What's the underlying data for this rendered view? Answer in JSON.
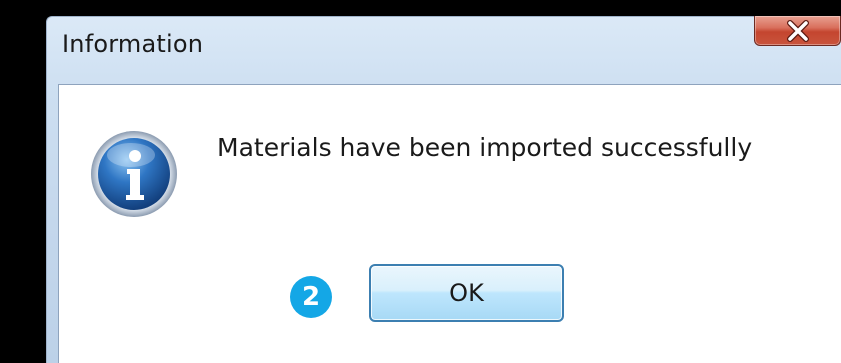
{
  "window": {
    "title": "Information",
    "close_icon": "close-icon"
  },
  "dialog": {
    "icon": "info-icon",
    "message": "Materials have been imported successfully",
    "ok_label": "OK"
  },
  "annotation": {
    "step_number": "2",
    "badge_color": "#14a7e6"
  },
  "colors": {
    "close_button": "#c4452f",
    "ok_button_border": "#3c7fb1",
    "info_icon": "#1f5ea8"
  }
}
